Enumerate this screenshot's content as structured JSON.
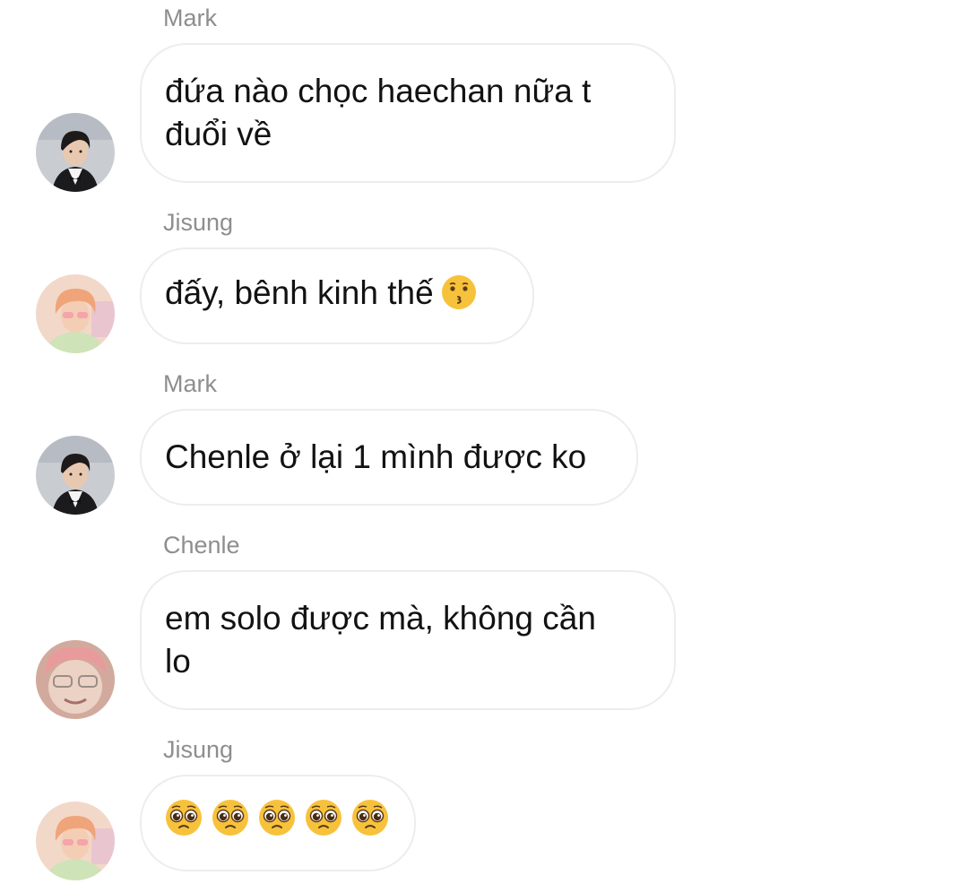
{
  "messages": [
    {
      "sender": "Mark",
      "avatar": "mark-avatar",
      "lines": [
        "đứa nào chọc haechan nữa t",
        "đuổi về"
      ]
    },
    {
      "sender": "Jisung",
      "avatar": "jisung-avatar",
      "text": "đấy, bênh kinh thế",
      "emoji": "kissing-face-emoji"
    },
    {
      "sender": "Mark",
      "avatar": "mark-avatar",
      "text": "Chenle ở lại 1 mình được ko"
    },
    {
      "sender": "Chenle",
      "avatar": "chenle-avatar",
      "lines": [
        "em solo được mà, không cần",
        "lo"
      ]
    },
    {
      "sender": "Jisung",
      "avatar": "jisung-avatar",
      "emoji": "pleading-face-emoji",
      "emoji_count": 5
    }
  ],
  "colors": {
    "sender_text": "#8e8e8e",
    "bubble_border": "#ededed",
    "message_text": "#121212",
    "emoji_yellow": "#f7c23b"
  }
}
